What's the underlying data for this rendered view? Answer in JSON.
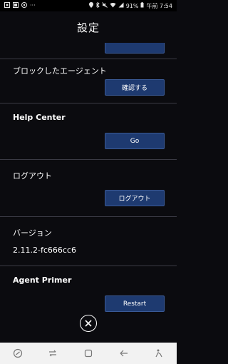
{
  "status_bar": {
    "battery": "91%",
    "time": "午前 7:54",
    "left_icons": [
      "image-icon",
      "cast-icon",
      "notification-icon",
      "more-dots-icon"
    ],
    "right_icons": [
      "location-icon",
      "bluetooth-icon",
      "mute-icon",
      "wifi-icon",
      "signal-icon",
      "battery-icon"
    ],
    "more_dots": "···"
  },
  "header": {
    "title": "設定"
  },
  "sections": {
    "blocked_agents": {
      "label": "ブロックしたエージェント",
      "button": "確認する"
    },
    "help_center": {
      "label": "Help Center",
      "button": "Go"
    },
    "logout": {
      "label": "ログアウト",
      "button": "ログアウト"
    },
    "version": {
      "label": "バージョン",
      "value": "2.11.2-fc666cc6"
    },
    "agent_primer": {
      "label": "Agent Primer",
      "button": "Restart"
    }
  },
  "nav_bar": {
    "items": [
      "assistant-icon",
      "recent-apps-icon",
      "home-icon",
      "back-icon",
      "accessibility-icon"
    ]
  }
}
